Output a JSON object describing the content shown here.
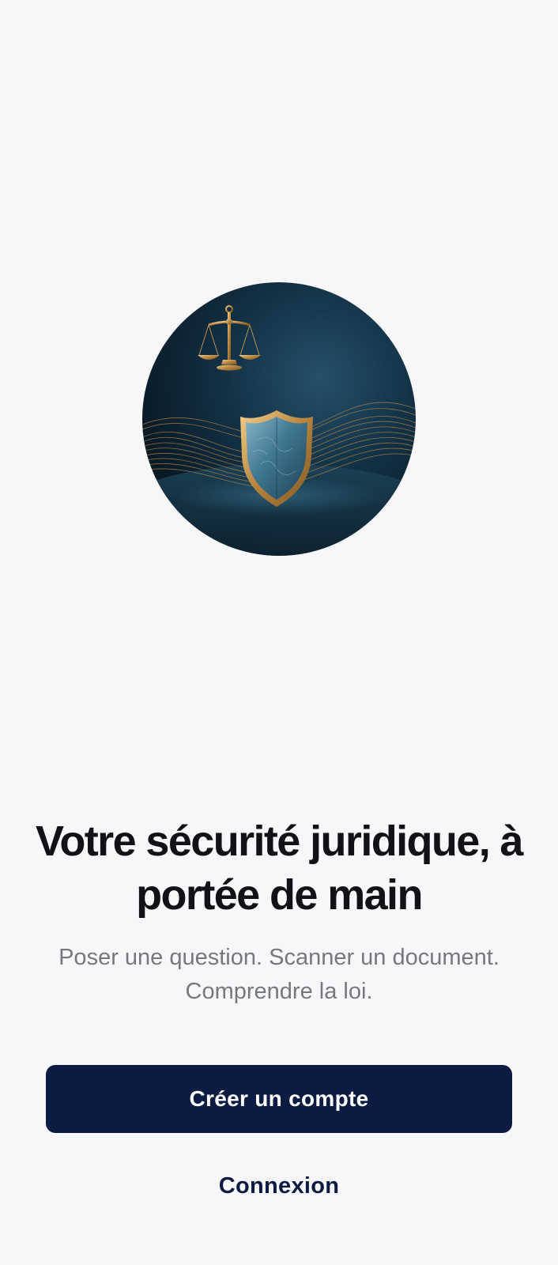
{
  "onboarding": {
    "hero_image": {
      "subject": "scales of justice above a shield with golden wave lines",
      "background_color": "#0f2a3a",
      "accent_color": "#c79a52"
    },
    "headline": "Votre sécurité juridique, à portée de main",
    "subtitle": "Poser une question. Scanner un document. Comprendre la loi."
  },
  "actions": {
    "create_account_label": "Créer un compte",
    "login_label": "Connexion"
  },
  "colors": {
    "page_background": "#f7f6f9",
    "primary": "#0c1b42",
    "headline": "#111216",
    "subtitle": "#767880"
  }
}
